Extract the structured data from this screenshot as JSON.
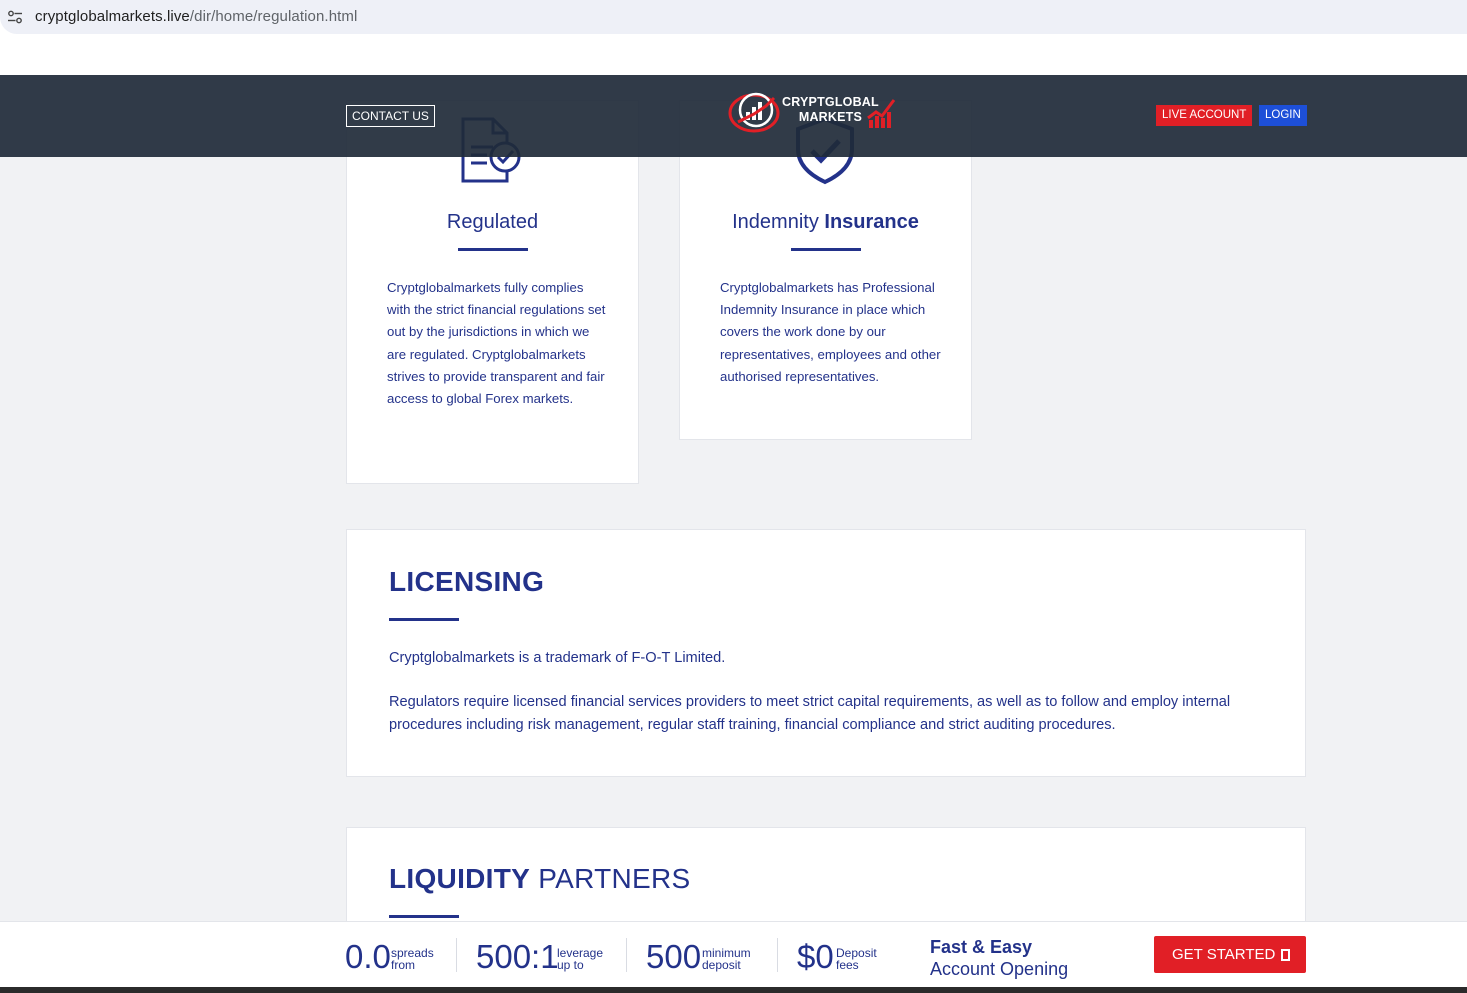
{
  "browser": {
    "url_host": "cryptglobalmarkets.live",
    "url_path": "/dir/home/regulation.html",
    "site_info_icon": "tune-icon"
  },
  "nav": {
    "contact_label": "CONTACT US",
    "logo_line1": "CRYPTGLOBAL",
    "logo_line2": "MARKETS",
    "live_account_label": "LIVE ACCOUNT",
    "login_label": "LOGIN",
    "colors": {
      "nav_bg": "#202a38",
      "live": "#e11f26",
      "login": "#1d4fd8"
    }
  },
  "cards": [
    {
      "icon": "document-check-icon",
      "title": "Regulated",
      "title_bold": "",
      "text": "Cryptglobalmarkets fully complies with the strict financial regulations set out by the jurisdictions in which we are regulated. Cryptglobalmarkets strives to provide transparent and fair access to global Forex markets."
    },
    {
      "icon": "shield-check-icon",
      "title": "Indemnity ",
      "title_bold": "Insurance",
      "text": "Cryptglobalmarkets has Professional Indemnity Insurance in place which covers the work done by our representatives, employees and other authorised representatives."
    }
  ],
  "licensing": {
    "title": "LICENSING",
    "p1": "Cryptglobalmarkets is a trademark of F-O-T Limited.",
    "p2": "Regulators require licensed financial services providers to meet strict capital requirements, as well as to follow and employ internal procedures including risk management, regular staff training, financial compliance and strict auditing procedures."
  },
  "liquidity": {
    "title_bold": "LIQUIDITY",
    "title_rest": " PARTNERS"
  },
  "bottombar": {
    "stats": [
      {
        "value": "0.0",
        "line1": "spreads",
        "line2": "from"
      },
      {
        "value": "500:1",
        "line1": "leverage",
        "line2": "up to"
      },
      {
        "value": "500",
        "line1": "minimum",
        "line2": "deposit"
      },
      {
        "value": "$0",
        "line1": "Deposit",
        "line2": "fees"
      }
    ],
    "fast_line1": "Fast & Easy",
    "fast_line2": "Account Opening",
    "cta_label": "GET STARTED"
  },
  "colors": {
    "brand_blue": "#23328a",
    "page_bg": "#f1f2f4",
    "accent_red": "#e11f26"
  }
}
